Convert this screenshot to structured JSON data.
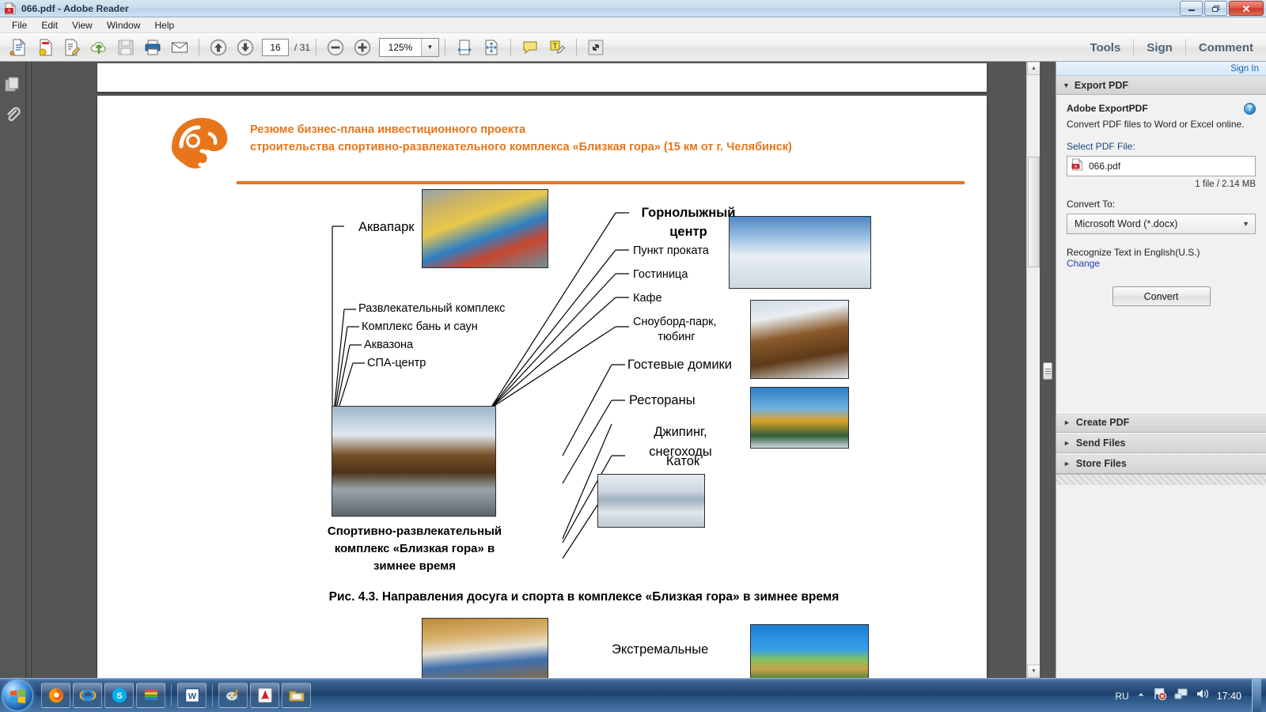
{
  "window": {
    "title": "066.pdf - Adobe Reader",
    "icon": "pdf-file-icon",
    "controls": {
      "minimize": "—",
      "restore": "❐",
      "close": "✕"
    }
  },
  "menubar": {
    "items": [
      "File",
      "Edit",
      "View",
      "Window",
      "Help"
    ]
  },
  "toolbar": {
    "icons": [
      "open-file-icon",
      "create-pdf-icon",
      "edit-pdf-icon",
      "upload-cloud-icon",
      "save-icon",
      "print-icon",
      "email-icon"
    ],
    "page_up_icon": "arrow-up-icon",
    "page_down_icon": "arrow-down-icon",
    "current_page": "16",
    "page_total": "/ 31",
    "zoom_out_icon": "zoom-out-icon",
    "zoom_in_icon": "zoom-in-icon",
    "zoom_value": "125%",
    "zoom_dropdown_icon": "chevron-down-icon",
    "fit_width_icon": "fit-width-icon",
    "fit_page_icon": "fit-page-icon",
    "comment_icon": "sticky-note-icon",
    "highlight_icon": "highlight-text-icon",
    "read_mode_icon": "read-mode-icon",
    "tabs": [
      "Tools",
      "Sign",
      "Comment"
    ]
  },
  "navpane": {
    "icons": [
      "page-thumbnails-icon",
      "attachments-paperclip-icon"
    ]
  },
  "taskpane": {
    "sign_in": "Sign In",
    "header": {
      "title": "Export PDF",
      "triangle": "▼"
    },
    "product_name": "Adobe ExportPDF",
    "help_icon": "?",
    "description": "Convert PDF files to Word or Excel online.",
    "select_label": "Select PDF File:",
    "file_name": "066.pdf",
    "file_icon": "pdf-file-icon",
    "file_meta": "1 file / 2.14 MB",
    "convert_to_label": "Convert To:",
    "convert_to_value": "Microsoft Word (*.docx)",
    "convert_to_arrow": "▼",
    "recognize_text": "Recognize Text in English(U.S.)",
    "change_link": "Change",
    "convert_button": "Convert",
    "accordion": [
      {
        "label": "Create PDF",
        "triangle": "►"
      },
      {
        "label": "Send Files",
        "triangle": "►"
      },
      {
        "label": "Store Files",
        "triangle": "►"
      }
    ]
  },
  "document": {
    "title_line1": "Резюме бизнес-плана инвестиционного проекта",
    "title_line2": "строительства спортивно-развлекательного комплекса «Близкая гора» (15 км от г. Челябинск)",
    "title_color": "#E8751A",
    "logo": "orange-abstract-logo",
    "labels": {
      "aquapark": "Аквапарк",
      "entertainment": "Развлекательный комплекс",
      "baths": "Комплекс бань и саун",
      "aquazone": "Аквазона",
      "spa": "СПА-центр",
      "ski_center_l1": "Горнолыжный",
      "ski_center_l2": "центр",
      "rental": "Пункт проката",
      "hotel": "Гостиница",
      "cafe": "Кафе",
      "snowpark_l1": "Сноуборд-парк,",
      "snowpark_l2": "тюбинг",
      "guest_houses": "Гостевые домики",
      "restaurants": "Рестораны",
      "jeeping_l1": "Джипинг,",
      "jeeping_l2": "снегоходы",
      "rink": "Каток",
      "extreme": "Экстремальные"
    },
    "center_caption_l1": "Спортивно-развлекательный",
    "center_caption_l2": "комплекс «Близкая гора» в",
    "center_caption_l3": "зимнее время",
    "figure_caption": "Рис. 4.3. Направления досуга и спорта в комплексе «Близкая гора» в зимнее время",
    "photos": [
      "waterpark-photo",
      "ski-slope-photo",
      "wooden-cabin-photo",
      "jeep-photo",
      "resort-building-render",
      "ice-rink-photo",
      "indoor-hall-photo",
      "extreme-sport-photo"
    ]
  },
  "taskbar": {
    "start": "windows-start-orb",
    "items": [
      "firefox-icon",
      "internet-explorer-icon",
      "skype-icon",
      "winrar-icon",
      "microsoft-word-icon",
      "paint-icon",
      "adobe-reader-icon",
      "file-explorer-icon"
    ],
    "tray": {
      "language": "RU",
      "show_hidden_icon": "chevron-up-icon",
      "action_center_icon": "flag-error-icon",
      "network_icon": "network-icon",
      "volume_icon": "speaker-icon",
      "clock": "17:40"
    }
  }
}
